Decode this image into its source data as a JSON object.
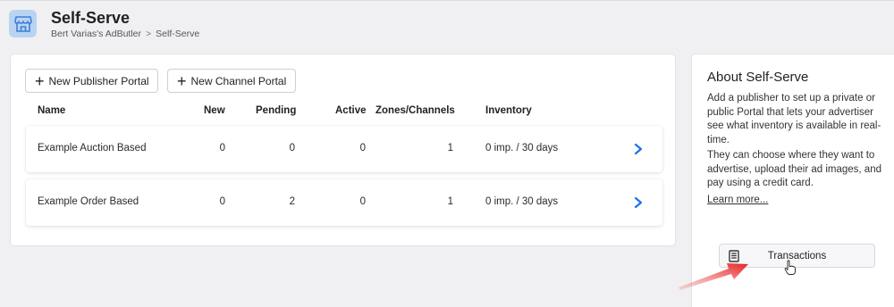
{
  "header": {
    "title": "Self-Serve",
    "breadcrumb": [
      "Bert Varias's AdButler",
      ">",
      "Self-Serve"
    ],
    "icon": "storefront-icon"
  },
  "toolbar": {
    "new_publisher_label": "New Publisher Portal",
    "new_channel_label": "New Channel Portal"
  },
  "table": {
    "columns": [
      "Name",
      "New",
      "Pending",
      "Active",
      "Zones/Channels",
      "Inventory"
    ],
    "rows": [
      {
        "name": "Example Auction Based",
        "new": "0",
        "pending": "0",
        "active": "0",
        "zones": "1",
        "inventory": "0 imp. / 30 days"
      },
      {
        "name": "Example Order Based",
        "new": "0",
        "pending": "2",
        "active": "0",
        "zones": "1",
        "inventory": "0 imp. / 30 days"
      }
    ]
  },
  "about": {
    "title": "About Self-Serve",
    "paragraph1": "Add a publisher to set up a private or public Portal that lets your advertiser see what inventory is available in real-time.",
    "paragraph2": "They can choose where they want to advertise, upload their ad images, and pay using a credit card.",
    "learn_more": "Learn more...",
    "transactions_label": "Transactions"
  },
  "colors": {
    "accent": "#1a73e8",
    "icon_bg": "#b9d4f2",
    "annotation_arrow": "#e52222"
  }
}
